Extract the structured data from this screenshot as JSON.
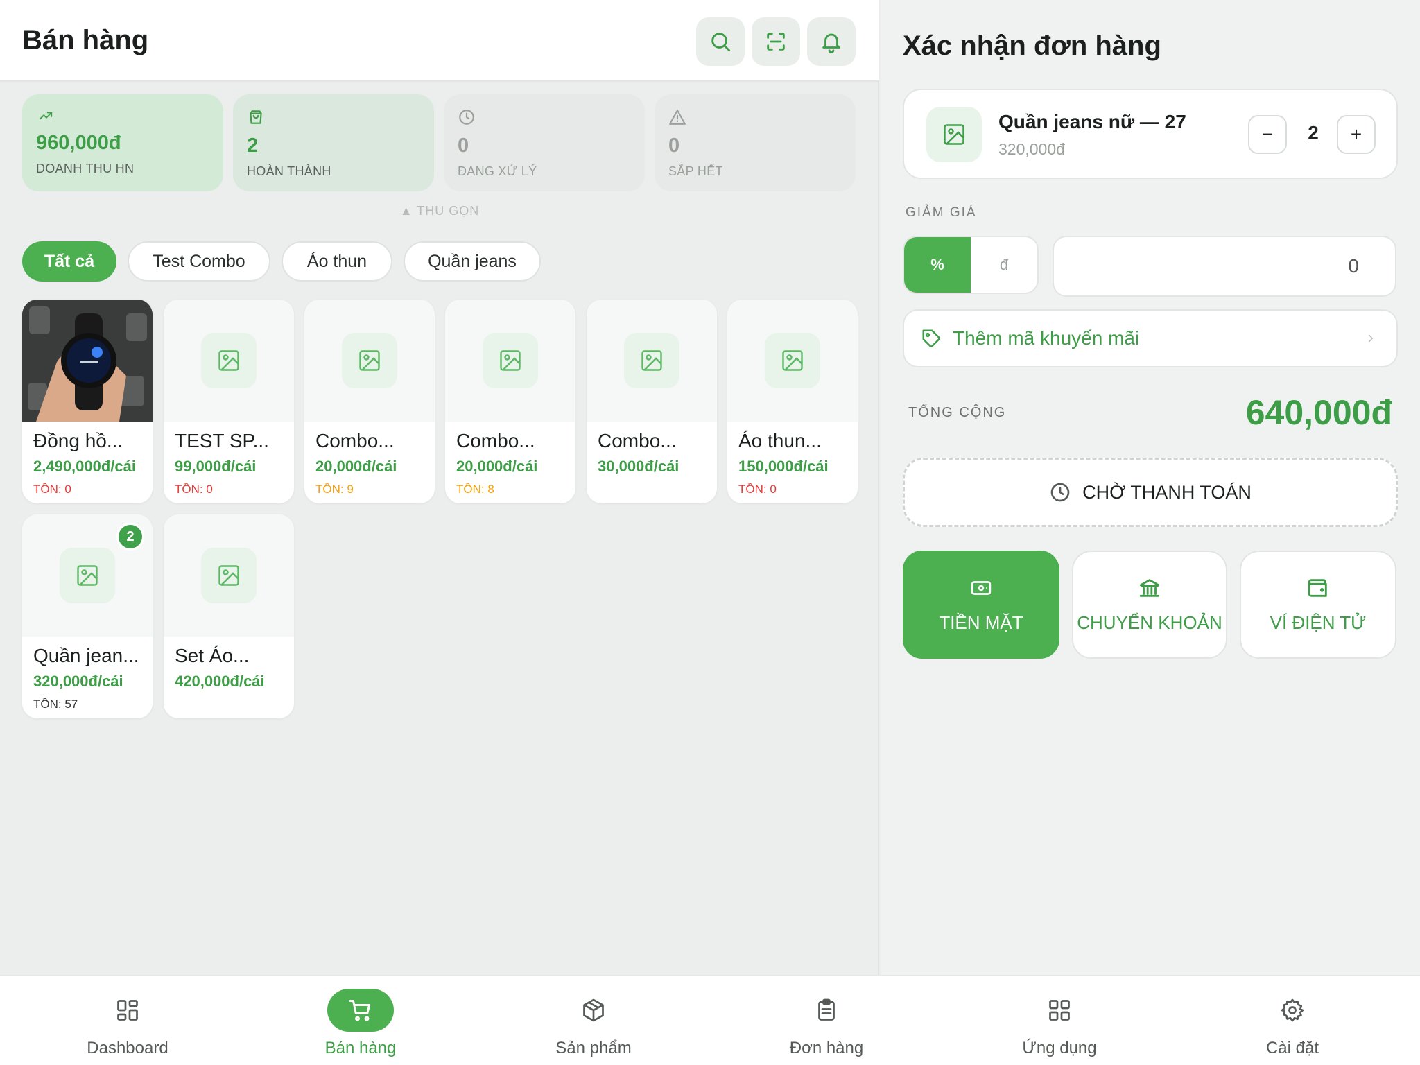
{
  "header": {
    "title": "Bán hàng"
  },
  "stats": [
    {
      "value": "960,000đ",
      "label": "DOANH THU HN"
    },
    {
      "value": "2",
      "label": "HOÀN THÀNH"
    },
    {
      "value": "0",
      "label": "ĐANG XỬ LÝ"
    },
    {
      "value": "0",
      "label": "SẮP HẾT"
    }
  ],
  "collapse_label": "▲ THU GỌN",
  "categories": [
    "Tất cả",
    "Test Combo",
    "Áo thun",
    "Quần jeans"
  ],
  "active_category": "Tất cả",
  "products": [
    {
      "name": "Đồng hồ...",
      "price": "2,490,000đ/cái",
      "stock": "TỒN: 0"
    },
    {
      "name": "TEST SP...",
      "price": "99,000đ/cái",
      "stock": "TỒN: 0"
    },
    {
      "name": "Combo...",
      "price": "20,000đ/cái",
      "stock": "TỒN: 9"
    },
    {
      "name": "Combo...",
      "price": "20,000đ/cái",
      "stock": "TỒN: 8"
    },
    {
      "name": "Combo...",
      "price": "30,000đ/cái",
      "stock": ""
    },
    {
      "name": "Áo thun...",
      "price": "150,000đ/cái",
      "stock": "TỒN: 0"
    },
    {
      "name": "Quần jean...",
      "price": "320,000đ/cái",
      "stock": "TỒN: 57",
      "badge": "2"
    },
    {
      "name": "Set Áo...",
      "price": "420,000đ/cái",
      "stock": ""
    }
  ],
  "order": {
    "title": "Xác nhận đơn hàng",
    "item": {
      "name": "Quần jeans nữ — 27",
      "price": "320,000đ",
      "qty": "2",
      "minus": "−",
      "plus": "+"
    },
    "discount_label": "GIẢM GIÁ",
    "discount_types": [
      "%",
      "đ"
    ],
    "discount_value": "0",
    "promo_label": "Thêm mã khuyến mãi",
    "total_label": "TỔNG CỘNG",
    "total_value": "640,000đ",
    "pending_label": "CHỜ THANH TOÁN",
    "payments": [
      "TIỀN MẶT",
      "CHUYỂN KHOẢN",
      "VÍ ĐIỆN TỬ"
    ]
  },
  "nav": [
    "Dashboard",
    "Bán hàng",
    "Sản phẩm",
    "Đơn hàng",
    "Ứng dụng",
    "Cài đặt"
  ],
  "colors": {
    "accent": "#4caf50",
    "price": "#3e9d47",
    "stock_out": "#e53935",
    "stock_low": "#f59e0b"
  }
}
